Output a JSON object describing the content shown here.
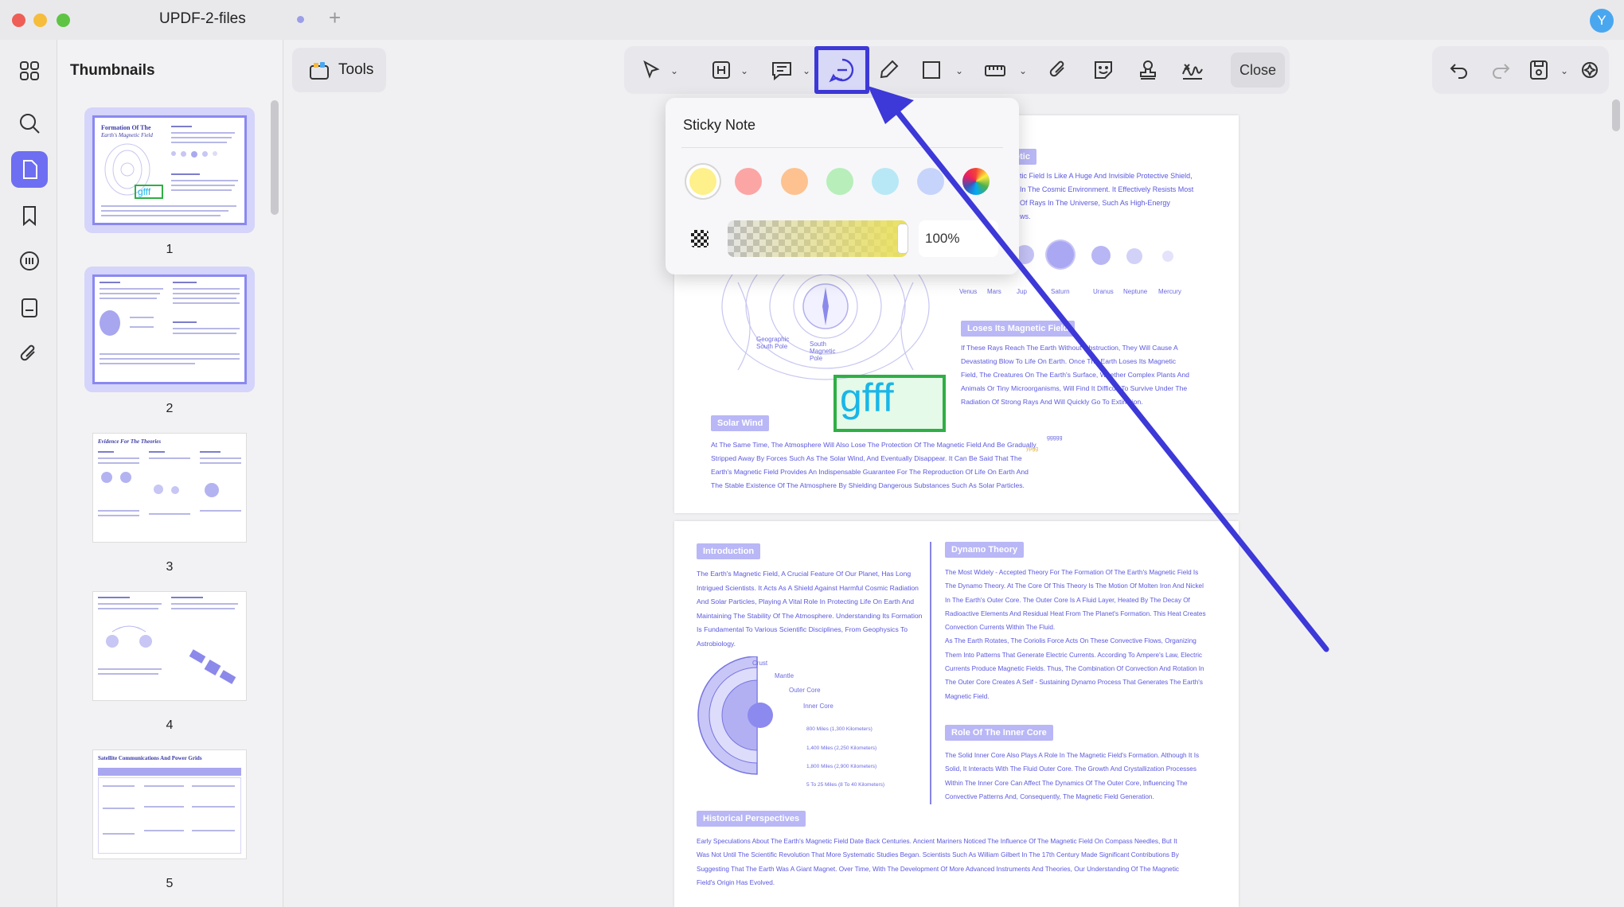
{
  "window": {
    "title": "UPDF-2-files",
    "avatar_letter": "Y"
  },
  "sidebar": {
    "items": [
      {
        "name": "thumbnails-view-icon"
      },
      {
        "name": "search-icon"
      },
      {
        "name": "pages-icon",
        "active": true
      },
      {
        "name": "bookmark-icon"
      },
      {
        "name": "comments-icon"
      },
      {
        "name": "forms-icon"
      },
      {
        "name": "attachment-icon"
      }
    ]
  },
  "thumbnails": {
    "title": "Thumbnails",
    "pages": [
      {
        "num": "1",
        "selected": true
      },
      {
        "num": "2",
        "selected": true
      },
      {
        "num": "3",
        "selected": false
      },
      {
        "num": "4",
        "selected": false
      },
      {
        "num": "5",
        "selected": false
      }
    ],
    "page1_heading": "Formation Of The",
    "page1_subheading": "Earth's Magnetic Field",
    "page1_stamp": "gfff",
    "page3_heading": "Evidence For The Theories",
    "page5_heading": "Satellite Communications And Power Grids"
  },
  "toolbar": {
    "tools_label": "Tools",
    "close_label": "Close",
    "active_tool": "sticky-note"
  },
  "sticky_note": {
    "title": "Sticky Note",
    "colors": [
      "#fef08a",
      "#fca5a5",
      "#fdc28f",
      "#b7eeba",
      "#b8e8f5",
      "#c6d4fb"
    ],
    "selected_color_index": 0,
    "opacity": "100%"
  },
  "document": {
    "page_a": {
      "heading_partial": "etic",
      "lines": [
        "tic Field Is Like A Huge And Invisible Protective Shield,",
        "In The Cosmic Environment. It Effectively Resists Most",
        "Of Rays In The Universe, Such As High-Energy",
        "ws."
      ],
      "planet_labels": [
        "Venus",
        "Mars",
        "Jup",
        "Saturn",
        "Uranus",
        "Neptune",
        "Mercury"
      ],
      "loses_heading": "Loses Its Magnetic Field",
      "loses_lines": [
        "If These Rays Reach The Earth Without Obstruction, They Will Cause A",
        "Devastating Blow To Life On Earth. Once The Earth Loses Its Magnetic",
        "Field, The Creatures On The Earth's Surface, Whether Complex Plants And",
        "Animals Or Tiny Microorganisms, Will Find It Difficult To Survive Under The",
        "Radiation Of Strong Rays And Will Quickly Go To Extinction."
      ],
      "geo_label_1": "Geographic",
      "geo_label_2": "South Pole",
      "mag_label_1": "South",
      "mag_label_2": "Magnetic",
      "mag_label_3": "Pole",
      "stamp_text": "gfff",
      "solar_heading": "Solar Wind",
      "solar_lines": [
        "At The Same Time, The Atmosphere Will Also Lose The Protection Of The Magnetic Field And Be Gradually",
        "Stripped Away By Forces Such As The Solar Wind, And Eventually Disappear. It Can Be Said That The",
        "Earth's Magnetic Field Provides An Indispensable Guarantee For The Reproduction Of Life On Earth And",
        "The Stable Existence Of The Atmosphere By Shielding Dangerous Substances Such As Solar Particles."
      ],
      "tiny_1": "ggggg",
      "tiny_2": "ypgg"
    },
    "page_b": {
      "intro_heading": "Introduction",
      "intro_lines": [
        "The Earth's Magnetic Field, A Crucial Feature Of Our Planet, Has Long",
        "Intrigued Scientists. It Acts As A Shield Against Harmful Cosmic Radiation",
        "And Solar Particles, Playing A Vital Role In Protecting Life On Earth And",
        "Maintaining The Stability Of The Atmosphere. Understanding Its Formation",
        "Is Fundamental To Various Scientific Disciplines, From Geophysics To",
        "Astrobiology."
      ],
      "layer_labels": [
        "Crust",
        "Mantle",
        "Outer Core",
        "Inner Core"
      ],
      "distance_labels": [
        "800 Miles (1,300 Kilometers)",
        "1,400 Miles (2,250 Kilometers)",
        "1,800 Miles (2,900 Kilometers)",
        "5 To 25 Miles (8 To 40 Kilometers)"
      ],
      "dynamo_heading": "Dynamo Theory",
      "dynamo_lines": [
        "The Most Widely - Accepted Theory For The Formation Of The Earth's Magnetic Field Is",
        "The Dynamo Theory. At The Core Of This Theory Is The Motion Of Molten Iron And Nickel",
        "In The Earth's Outer Core. The Outer Core Is A Fluid Layer, Heated By The Decay Of",
        "Radioactive Elements And Residual Heat From The Planet's Formation. This Heat Creates",
        "Convection Currents Within The Fluid.",
        "As The Earth Rotates, The Coriolis Force Acts On These Convective Flows, Organizing",
        "Them Into Patterns That Generate Electric Currents. According To Ampere's Law, Electric",
        "Currents Produce Magnetic Fields. Thus, The Combination Of Convection And Rotation In",
        "The Outer Core Creates A Self - Sustaining Dynamo Process That Generates The Earth's",
        "Magnetic Field."
      ],
      "inner_heading": "Role Of The Inner Core",
      "inner_lines": [
        "The Solid Inner Core Also Plays A Role In The Magnetic Field's Formation. Although It Is",
        "Solid, It Interacts With The Fluid Outer Core. The Growth And Crystallization Processes",
        "Within The Inner Core Can Affect The Dynamics Of The Outer Core, Influencing The",
        "Convective Patterns And, Consequently, The Magnetic Field Generation."
      ],
      "hist_heading": "Historical Perspectives",
      "hist_lines": [
        "Early Speculations About The Earth's Magnetic Field Date Back Centuries. Ancient Mariners Noticed The Influence Of The Magnetic Field On Compass Needles, But It",
        "Was Not Until The Scientific Revolution That More Systematic Studies Began. Scientists Such As William Gilbert In The 17th Century Made Significant Contributions By",
        "Suggesting That The Earth Was A Giant Magnet. Over Time, With The Development Of More Advanced Instruments And Theories, Our Understanding Of The Magnetic",
        "Field's Origin Has Evolved."
      ]
    }
  },
  "colors": {
    "accent": "#6e6ef2",
    "highlight_border": "#3d38d8",
    "doc_text": "#5b58de",
    "heading_chip": "#b9b7f6"
  }
}
